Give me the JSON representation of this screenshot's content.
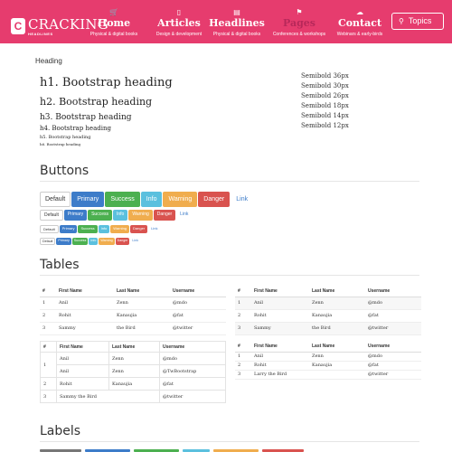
{
  "brand": {
    "name": "CRACKING",
    "sub": "HEADLINES",
    "logo_letter": "C"
  },
  "nav": [
    {
      "title": "Home",
      "sub": "Physical & digital books",
      "icon": "cart-icon",
      "glyph": "🛒"
    },
    {
      "title": "Articles",
      "sub": "Design & development",
      "icon": "phone-icon",
      "glyph": "▯"
    },
    {
      "title": "Headlines",
      "sub": "Physical & digital books",
      "icon": "book-icon",
      "glyph": "▤"
    },
    {
      "title": "Pages",
      "sub": "Conferences & workshops",
      "icon": "flag-icon",
      "glyph": "⚑"
    },
    {
      "title": "Contact",
      "sub": "Webinars & early-birds",
      "icon": "cloud-icon",
      "glyph": "☁"
    }
  ],
  "topics": {
    "label": "Topics",
    "icon": "search-icon",
    "glyph": "⚲"
  },
  "heading_section": {
    "label": "Heading",
    "headings": [
      "h1. Bootstrap heading",
      "h2. Bootstrap heading",
      "h3. Bootstrap heading",
      "h4. Bootstrap heading",
      "h5. Bootstrap heading",
      "h6. Bootstrap heading"
    ],
    "sizes": [
      "Semibold 36px",
      "Semibold 30px",
      "Semibold 26px",
      "Semibold 18px",
      "Semibold 14px",
      "Semibold 12px"
    ]
  },
  "buttons_section": {
    "title": "Buttons",
    "labels": [
      "Default",
      "Primary",
      "Success",
      "Info",
      "Warning",
      "Danger",
      "Link"
    ]
  },
  "tables_section": {
    "title": "Tables",
    "headers": [
      "#",
      "First Name",
      "Last Name",
      "Username"
    ],
    "table_a": [
      [
        "1",
        "Anil",
        "Zenn",
        "@mdo"
      ],
      [
        "2",
        "Rohit",
        "Kanaujia",
        "@fat"
      ],
      [
        "3",
        "Sammy",
        "the Bird",
        "@twitter"
      ]
    ],
    "table_b": [
      [
        "1",
        "Anil",
        "Zenn",
        "@mdo"
      ],
      [
        "2",
        "Rohit",
        "Kanaujia",
        "@fat"
      ],
      [
        "3",
        "Sammy",
        "the Bird",
        "@twitter"
      ]
    ],
    "table_c": [
      [
        "1",
        "Anil",
        "Zenn",
        "@mdo"
      ],
      [
        "",
        "Anil",
        "Zenn",
        "@TwBootstrap"
      ],
      [
        "2",
        "Rohit",
        "Kanaujia",
        "@fat"
      ],
      [
        "3",
        "Sammy the Bird",
        "",
        "@twitter"
      ]
    ],
    "table_d": [
      [
        "1",
        "Anil",
        "Zenn",
        "@mdo"
      ],
      [
        "2",
        "Rohit",
        "Kanaujia",
        "@fat"
      ],
      [
        "3",
        "Larry the Bird",
        "",
        "@twitter"
      ]
    ]
  },
  "labels_section": {
    "title": "Labels"
  },
  "colors": {
    "brand": "#e63c6e",
    "primary": "#3d7cc9",
    "success": "#4cb050",
    "info": "#5bc0de",
    "warning": "#f0ad4e",
    "danger": "#d9534f"
  }
}
